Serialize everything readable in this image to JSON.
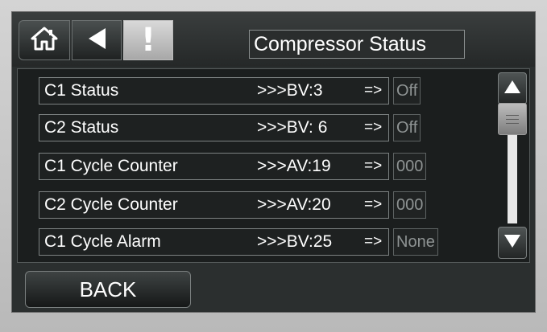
{
  "header": {
    "title": "Compressor Status",
    "alert_glyph": "!"
  },
  "rows": [
    {
      "name": "C1 Status",
      "ref": ">>>BV:3",
      "arrow": "=>",
      "value": "Off"
    },
    {
      "name": "C2 Status",
      "ref": ">>>BV: 6",
      "arrow": "=>",
      "value": "Off"
    },
    {
      "name": "C1 Cycle Counter",
      "ref": ">>>AV:19",
      "arrow": "=>",
      "value": "000"
    },
    {
      "name": "C2 Cycle Counter",
      "ref": ">>>AV:20",
      "arrow": "=>",
      "value": "000"
    },
    {
      "name": "C1 Cycle Alarm",
      "ref": ">>>BV:25",
      "arrow": "=>",
      "value": "None"
    }
  ],
  "footer": {
    "back_label": "BACK"
  },
  "icons": {
    "home": "home-icon",
    "back": "back-arrow-icon",
    "alert": "alert-icon",
    "scroll_up": "triangle-up-icon",
    "scroll_down": "triangle-down-icon"
  },
  "colors": {
    "screen_bg": "#2b2f2f",
    "text": "#ffffff",
    "value_text": "#8f9494",
    "alert_button": "#c8c8c8"
  }
}
